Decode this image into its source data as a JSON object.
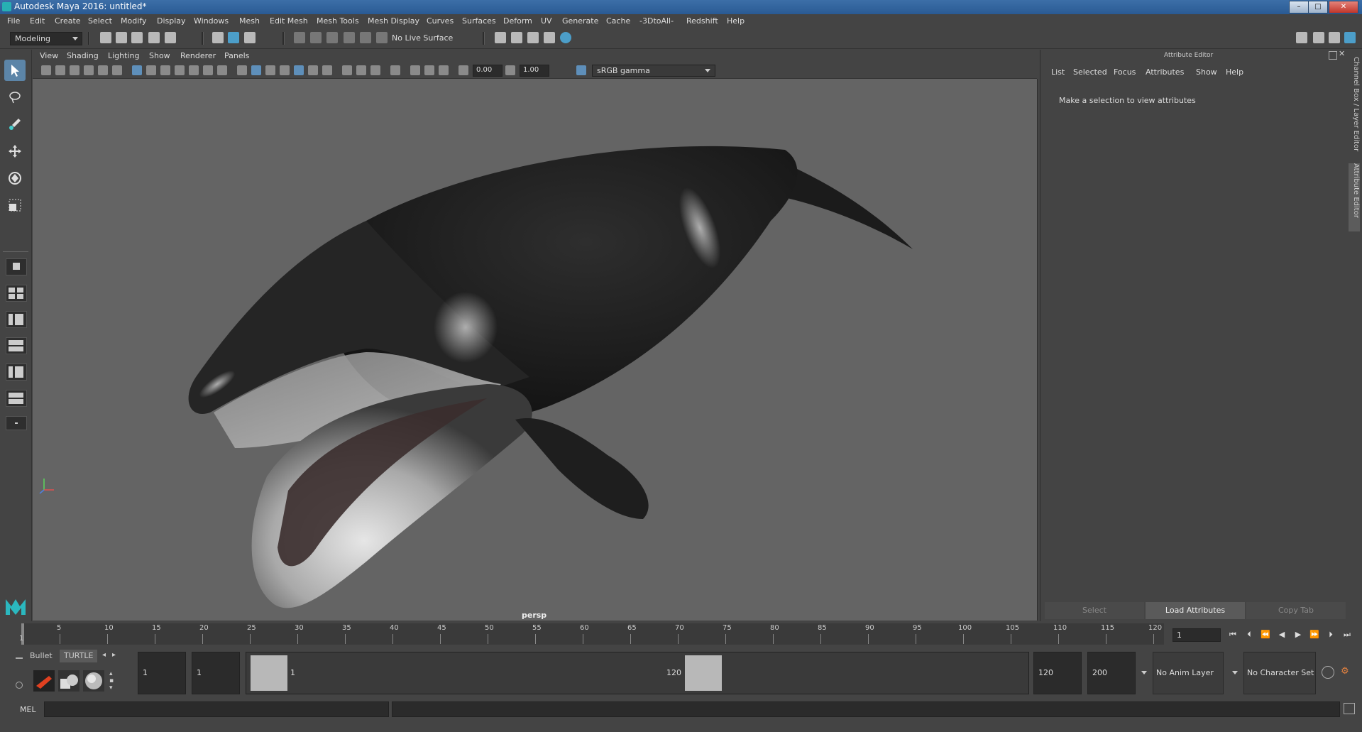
{
  "window": {
    "title": "Autodesk Maya 2016: untitled*",
    "buttons": [
      "–",
      "□",
      "✕"
    ]
  },
  "menubar": [
    "File",
    "Edit",
    "Create",
    "Select",
    "Modify",
    "Display",
    "Windows",
    "Mesh",
    "Edit Mesh",
    "Mesh Tools",
    "Mesh Display",
    "Curves",
    "Surfaces",
    "Deform",
    "UV",
    "Generate",
    "Cache",
    "-3DtoAll-",
    "Redshift",
    "Help"
  ],
  "statusline": {
    "mode": "Modeling",
    "live_surface": "No Live Surface"
  },
  "panel": {
    "menus": [
      "View",
      "Shading",
      "Lighting",
      "Show",
      "Renderer",
      "Panels"
    ],
    "exposure": "0.00",
    "gamma": "1.00",
    "color_space": "sRGB gamma",
    "camera_label": "persp"
  },
  "attribute_editor": {
    "title": "Attribute Editor",
    "menus": [
      "List",
      "Selected",
      "Focus",
      "Attributes",
      "Show",
      "Help"
    ],
    "message": "Make a selection to view attributes",
    "buttons": {
      "select": "Select",
      "load": "Load Attributes",
      "copy": "Copy Tab"
    },
    "side_tabs": [
      "Channel Box / Layer Editor",
      "Attribute Editor"
    ]
  },
  "timeslider": {
    "ticks": [
      "1",
      "5",
      "10",
      "15",
      "20",
      "25",
      "30",
      "35",
      "40",
      "45",
      "50",
      "55",
      "60",
      "65",
      "70",
      "75",
      "80",
      "85",
      "90",
      "95",
      "100",
      "105",
      "110",
      "115",
      "120"
    ],
    "current_frame": "1"
  },
  "range": {
    "shelf_tabs": [
      "Bullet",
      "TURTLE"
    ],
    "start": "1",
    "playback_start": "1",
    "slider_start": "1",
    "slider_end": "120",
    "playback_end": "120",
    "end": "200",
    "anim_layer": "No Anim Layer",
    "character_set": "No Character Set"
  },
  "cmdline": {
    "label": "MEL"
  },
  "colors": {
    "viewport": "#646464",
    "ui": "#444444",
    "accent": "#5c85a8",
    "titlebar": "#2a5a94"
  }
}
